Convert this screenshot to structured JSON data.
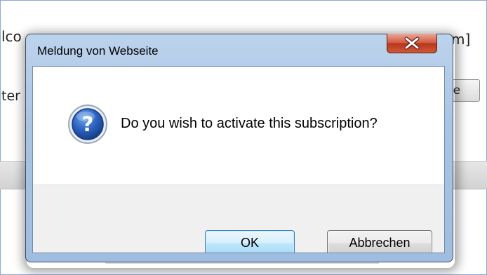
{
  "background_page": {
    "left_text_fragment": "lco",
    "right_text_fragment": "m]",
    "left_text_fragment_2": "ter",
    "partial_button_label": "te"
  },
  "dialog": {
    "title": "Meldung von Webseite",
    "close_icon": "close-x-icon",
    "message_icon": "question-icon",
    "message": "Do you wish to activate this subscription?",
    "buttons": {
      "ok_label": "OK",
      "cancel_label": "Abbrechen"
    }
  },
  "colors": {
    "title_bar_blue": "#a9c4e3",
    "close_button_red": "#c7442b",
    "ok_button_blue": "#bee6fd",
    "button_area_gray": "#f0f0f0",
    "question_icon_blue": "#1f4f9e"
  }
}
